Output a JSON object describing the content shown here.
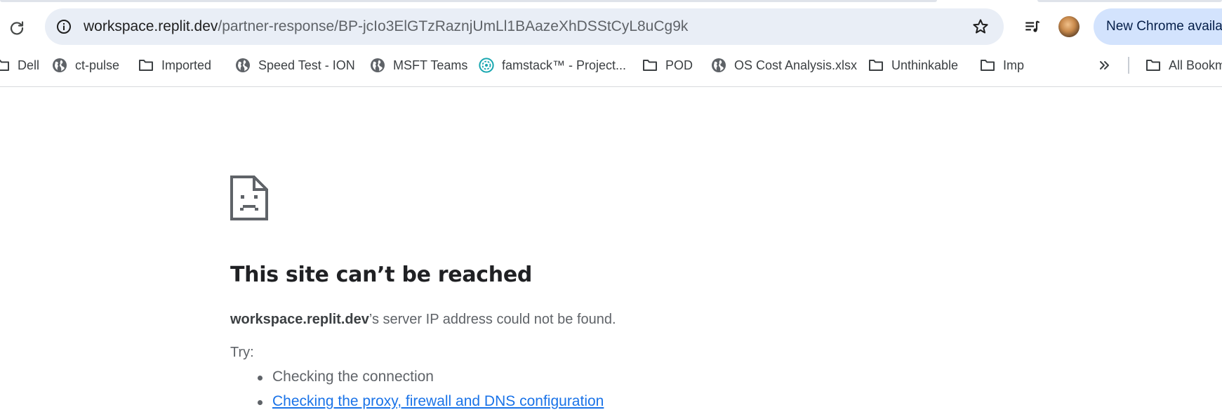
{
  "browser": {
    "url_host": "workspace.replit.dev",
    "url_path": "/partner-response/BP-jcIo3ElGTzRaznjUmLl1BAazeXhDSStCyL8uCg9k",
    "update_button_label": "New Chrome available"
  },
  "bookmarks": [
    {
      "label": "Dell",
      "icon": "folder-icon"
    },
    {
      "label": "ct-pulse",
      "icon": "globe-icon"
    },
    {
      "label": "Imported",
      "icon": "folder-icon"
    },
    {
      "label": "Speed Test - ION",
      "icon": "globe-icon"
    },
    {
      "label": "MSFT Teams",
      "icon": "globe-icon"
    },
    {
      "label": "famstack™ - Project...",
      "icon": "famstack-icon"
    },
    {
      "label": "POD",
      "icon": "folder-icon"
    },
    {
      "label": "OS Cost Analysis.xlsx",
      "icon": "globe-icon"
    },
    {
      "label": "Unthinkable",
      "icon": "folder-icon"
    },
    {
      "label": "Imp",
      "icon": "folder-icon"
    }
  ],
  "all_bookmarks_label": "All Bookmarks",
  "error": {
    "title": "This site can’t be reached",
    "host": "workspace.replit.dev",
    "description_suffix": "’s server IP address could not be found.",
    "try_label": "Try:",
    "suggestions": [
      "Checking the connection",
      "Checking the proxy, firewall and DNS configuration"
    ]
  },
  "colors": {
    "omnibox_bg": "#e9eef6",
    "update_pill_bg": "#d3e3fd",
    "link": "#1a73e8",
    "title": "#202124",
    "body_text": "#5f6368"
  }
}
